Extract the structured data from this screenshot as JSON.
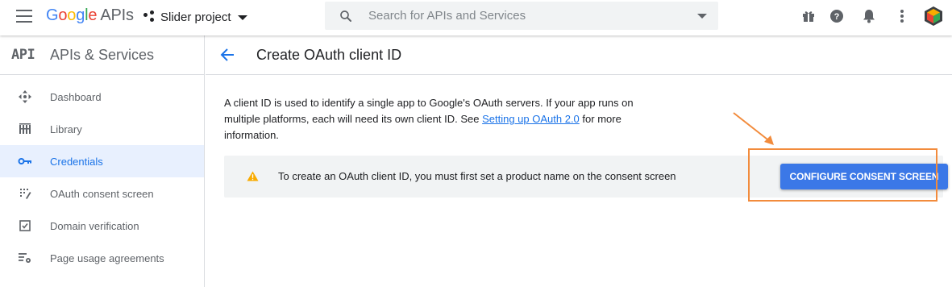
{
  "header": {
    "logo_google": "Google",
    "logo_apis": "APIs",
    "project_name": "Slider project",
    "search_placeholder": "Search for APIs and Services"
  },
  "icons": {
    "menu": "hamburger-icon",
    "project": "project-dots-icon",
    "search": "search-icon",
    "gift": "gift-icon",
    "help": "help-icon",
    "notifications": "bell-icon",
    "more": "more-vert-icon",
    "avatar": "avatar-icon"
  },
  "sidebar": {
    "badge": "API",
    "title": "APIs & Services",
    "items": [
      {
        "label": "Dashboard",
        "icon": "dashboard-icon",
        "active": false
      },
      {
        "label": "Library",
        "icon": "library-icon",
        "active": false
      },
      {
        "label": "Credentials",
        "icon": "key-icon",
        "active": true
      },
      {
        "label": "OAuth consent screen",
        "icon": "consent-icon",
        "active": false
      },
      {
        "label": "Domain verification",
        "icon": "checkbox-icon",
        "active": false
      },
      {
        "label": "Page usage agreements",
        "icon": "settings-list-icon",
        "active": false
      }
    ]
  },
  "main": {
    "title": "Create OAuth client ID",
    "description_before_link": "A client ID is used to identify a single app to Google's OAuth servers. If your app runs on multiple platforms, each will need its own client ID. See ",
    "description_link": "Setting up OAuth 2.0",
    "description_after_link": " for more information.",
    "notice_text": "To create an OAuth client ID, you must first set a product name on the consent screen",
    "cta_label": "CONFIGURE CONSENT SCREEN"
  },
  "colors": {
    "accent": "#1a73e8",
    "button": "#3b78e7",
    "highlight": "#f28b3c",
    "warning": "#f9ab00"
  }
}
